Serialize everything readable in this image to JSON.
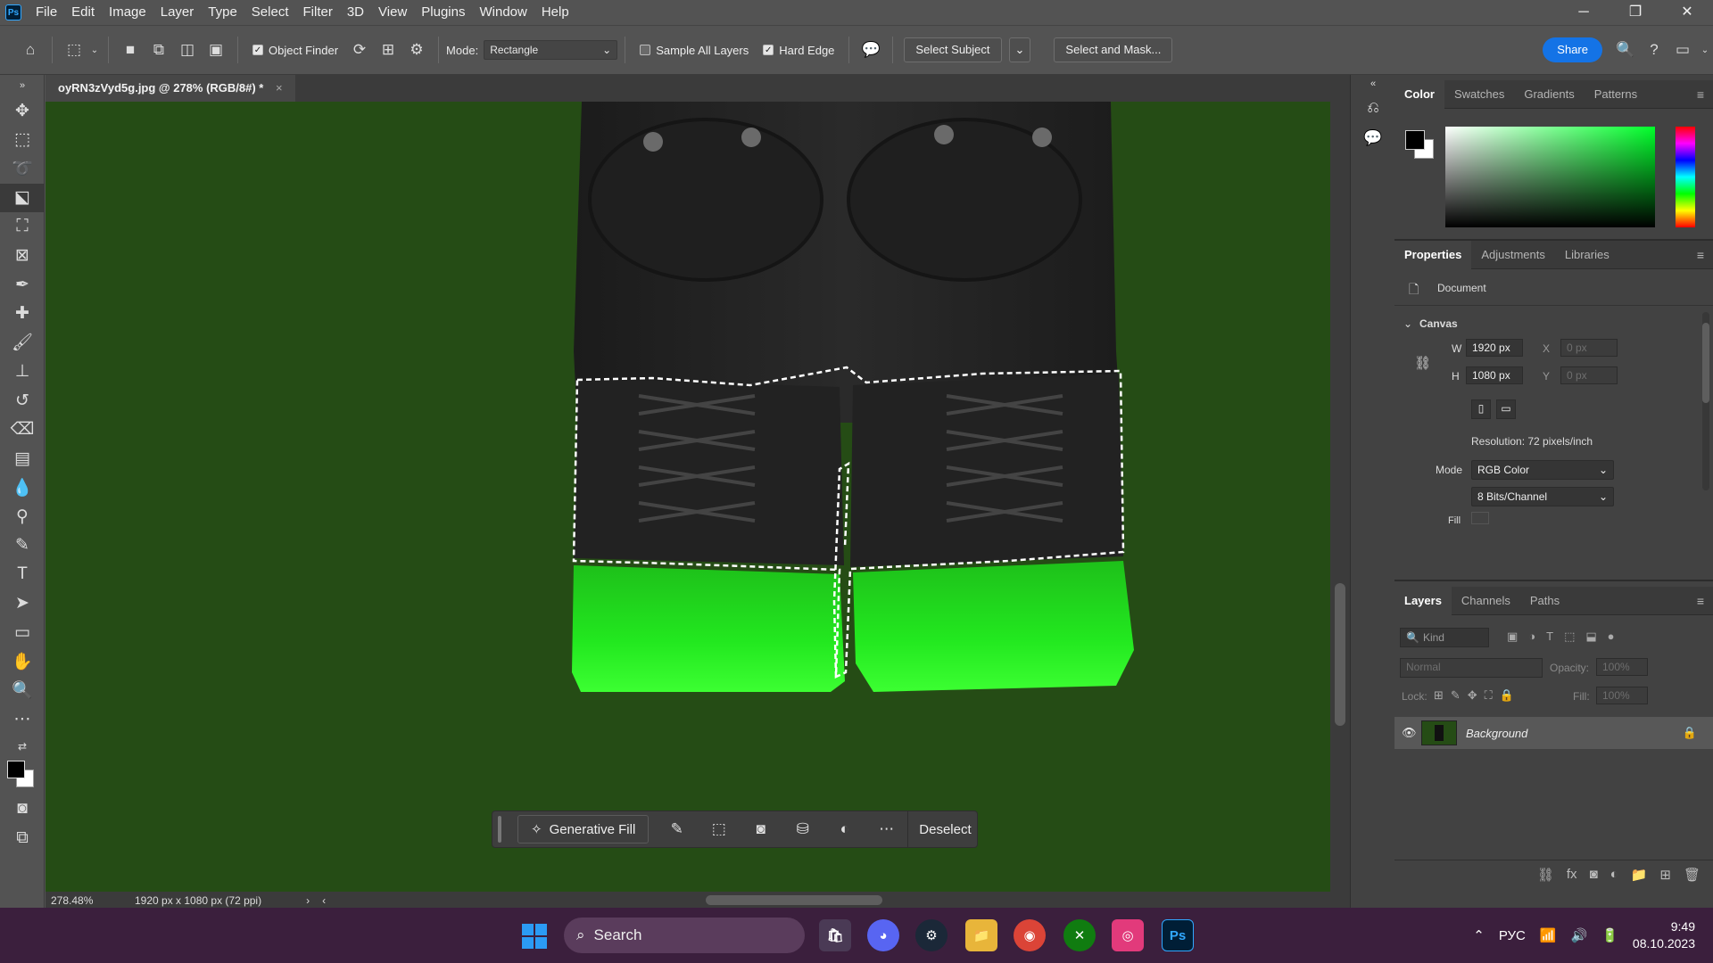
{
  "menubar": {
    "logo": "Ps",
    "items": [
      "File",
      "Edit",
      "Image",
      "Layer",
      "Type",
      "Select",
      "Filter",
      "3D",
      "View",
      "Plugins",
      "Window",
      "Help"
    ],
    "window_controls": [
      "─",
      "❐",
      "✕"
    ]
  },
  "options_bar": {
    "object_finder_label": "Object Finder",
    "object_finder_checked": true,
    "mode_label": "Mode:",
    "mode_value": "Rectangle",
    "sample_all_layers_label": "Sample All Layers",
    "sample_all_layers_checked": false,
    "hard_edge_label": "Hard Edge",
    "hard_edge_checked": true,
    "select_subject_label": "Select Subject",
    "select_and_mask_label": "Select and Mask...",
    "share_label": "Share"
  },
  "document": {
    "tab_title": "oyRN3zVyd5g.jpg @ 278% (RGB/8#) *",
    "tab_close": "×",
    "zoom": "278.48%",
    "doc_info": "1920 px x 1080 px (72 ppi)"
  },
  "context_bar": {
    "generative_fill_label": "Generative Fill",
    "deselect_label": "Deselect"
  },
  "color_panel": {
    "tabs": [
      "Color",
      "Swatches",
      "Gradients",
      "Patterns"
    ],
    "active_tab": "Color",
    "foreground": "#000000",
    "background": "#ffffff",
    "hue_color": "#00ff2a"
  },
  "properties_panel": {
    "tabs": [
      "Properties",
      "Adjustments",
      "Libraries"
    ],
    "document_label": "Document",
    "canvas_label": "Canvas",
    "w_label": "W",
    "w_value": "1920 px",
    "h_label": "H",
    "h_value": "1080 px",
    "x_label": "X",
    "x_value": "0 px",
    "y_label": "Y",
    "y_value": "0 px",
    "resolution": "Resolution: 72 pixels/inch",
    "mode_label": "Mode",
    "mode_value": "RGB Color",
    "bits_value": "8 Bits/Channel",
    "fill_label": "Fill"
  },
  "layers_panel": {
    "tabs": [
      "Layers",
      "Channels",
      "Paths"
    ],
    "kind_placeholder": "Kind",
    "blend_mode": "Normal",
    "opacity_label": "Opacity:",
    "opacity_value": "100%",
    "lock_label": "Lock:",
    "fill_label": "Fill:",
    "fill_value": "100%",
    "layer_name": "Background"
  },
  "taskbar": {
    "search_label": "Search",
    "language": "РУС",
    "time": "9:49",
    "date": "08.10.2023",
    "ps_label": "Ps"
  },
  "colors": {
    "canvas_green": "#254c15",
    "neon_green": "#22e81f",
    "accent_blue": "#1473e6"
  }
}
